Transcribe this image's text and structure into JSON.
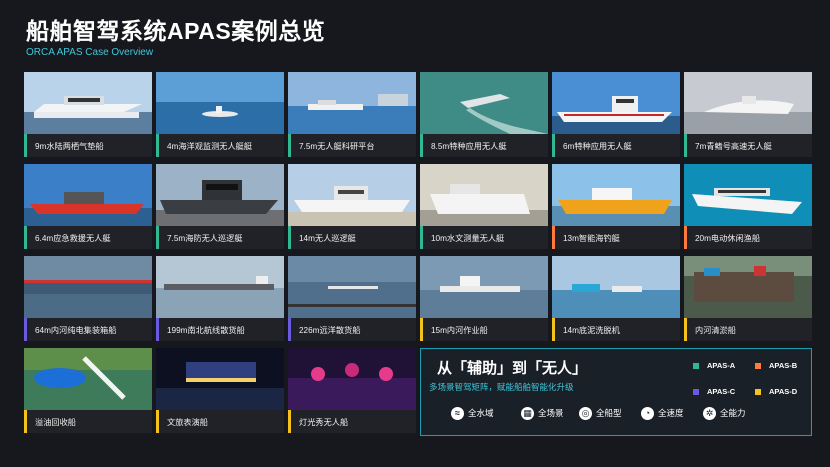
{
  "header": {
    "title": "船舶智驾系统APAS案例总览",
    "subtitle": "ORCA APAS Case Overview"
  },
  "cases": [
    {
      "label": "9m水陆两栖气垫船",
      "tier": "a"
    },
    {
      "label": "4m海洋观监测无人艇艇",
      "tier": "a"
    },
    {
      "label": "7.5m无人艇科研平台",
      "tier": "a"
    },
    {
      "label": "8.5m特种应用无人艇",
      "tier": "a"
    },
    {
      "label": "6m特种应用无人艇",
      "tier": "a"
    },
    {
      "label": "7m青鳍号高速无人艇",
      "tier": "a"
    },
    {
      "label": "6.4m应急救援无人艇",
      "tier": "a"
    },
    {
      "label": "7.5m海防无人巡逻艇",
      "tier": "a"
    },
    {
      "label": "14m无人巡逻艇",
      "tier": "a"
    },
    {
      "label": "10m水文测量无人艇",
      "tier": "a"
    },
    {
      "label": "13m智能海钓艇",
      "tier": "b"
    },
    {
      "label": "20m电动休闲渔船",
      "tier": "b"
    },
    {
      "label": "64m内河纯电集装箱船",
      "tier": "c"
    },
    {
      "label": "199m南北航线散货船",
      "tier": "c"
    },
    {
      "label": "226m远洋散货船",
      "tier": "c"
    },
    {
      "label": "15m内河作业船",
      "tier": "d"
    },
    {
      "label": "14m底泥洗脱机",
      "tier": "d"
    },
    {
      "label": "内河清淤船",
      "tier": "d"
    },
    {
      "label": "溢油回收船",
      "tier": "d"
    },
    {
      "label": "文旅表演船",
      "tier": "d"
    },
    {
      "label": "灯光秀无人船",
      "tier": "d"
    }
  ],
  "panel": {
    "heading": "从「辅助」到「无人」",
    "subheading": "多场景智驾矩阵，赋能船舶智能化升级",
    "legend": [
      {
        "label": "APAS-A",
        "color": "#2fb892"
      },
      {
        "label": "APAS-B",
        "color": "#ff7a3d"
      },
      {
        "label": "APAS-C",
        "color": "#6a5ae0"
      },
      {
        "label": "APAS-D",
        "color": "#f4c21b"
      }
    ],
    "features": [
      {
        "label": "全水域",
        "icon": "wave-icon"
      },
      {
        "label": "全场景",
        "icon": "grid-icon"
      },
      {
        "label": "全船型",
        "icon": "globe-icon"
      },
      {
        "label": "全速度",
        "icon": "speedometer-icon"
      },
      {
        "label": "全能力",
        "icon": "gear-icon"
      }
    ]
  }
}
